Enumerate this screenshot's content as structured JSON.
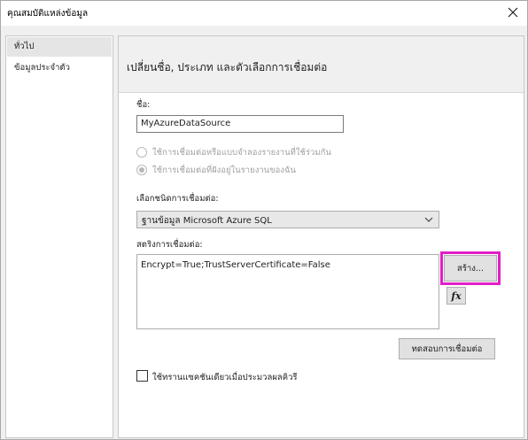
{
  "window": {
    "title": "คุณสมบัติแหล่งข้อมูล",
    "close_glyph": "close-icon"
  },
  "sidebar": {
    "items": [
      {
        "label": "ทั่วไป",
        "selected": true
      },
      {
        "label": "ข้อมูลประจำตัว",
        "selected": false
      }
    ]
  },
  "main": {
    "header": "เปลี่ยนชื่อ, ประเภท และตัวเลือกการเชื่อมต่อ",
    "name_label": "ชื่อ:",
    "name_value": "MyAzureDataSource",
    "radio_shared": {
      "label": "ใช้การเชื่อมต่อหรือแบบจำลองรายงานที่ใช้ร่วมกัน",
      "checked": false,
      "enabled": false
    },
    "radio_embedded": {
      "label": "ใช้การเชื่อมต่อที่ฝังอยู่ในรายงานของฉัน",
      "checked": true,
      "enabled": false
    },
    "conn_type_label": "เลือกชนิดการเชื่อมต่อ:",
    "conn_type_value": "ฐานข้อมูล Microsoft Azure SQL",
    "conn_string_label": "สตริงการเชื่อมต่อ:",
    "conn_string_value": "Encrypt=True;TrustServerCertificate=False",
    "build_button": "สร้าง...",
    "fx_button": "fx",
    "test_button": "ทดสอบการเชื่อมต่อ",
    "single_txn_checkbox": {
      "label": "ใช้ทรานแซคชันเดียวเมื่อประมวลผลคิวรี",
      "checked": false
    }
  },
  "colors": {
    "highlight": "#e31ec8",
    "dialog_bg": "#f0f0f0",
    "disabled_text": "#a0a0a0"
  }
}
